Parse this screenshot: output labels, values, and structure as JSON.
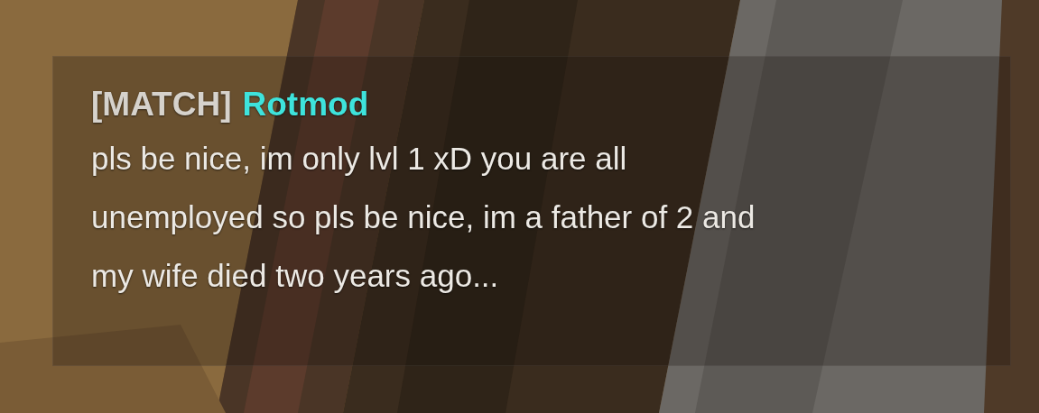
{
  "chat": {
    "messages": [
      {
        "channel": "[MATCH]",
        "sender": "Rotmod",
        "color": "#3ee3dc",
        "lines": [
          "pls be nice, im only lvl 1 xD you are all",
          "unemployed so pls be nice, im a father of 2 and",
          "my wife died two years ago..."
        ]
      }
    ]
  }
}
